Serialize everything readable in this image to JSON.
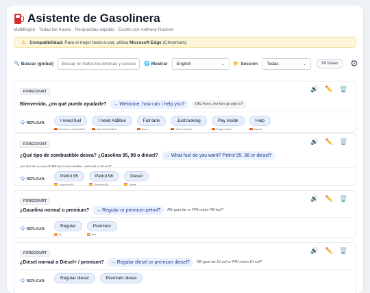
{
  "header": {
    "title": "Asistente de Gasolinera",
    "subtitle": "Multilingüe · Todas las frases · Respuestas rápidas · Escrito por Anthony Rostron"
  },
  "banner": {
    "prefix": "Compatibilidad:",
    "text": " Para el mejor texto-a-voz, utiliza ",
    "highlight": "Microsoft Edge",
    "suffix": " (Chromium)."
  },
  "toolbar": {
    "search_label": "Buscar (global)",
    "search_placeholder": "Buscar en todos los idiomas y secciones",
    "show_label": "Mostrar",
    "language_value": "English",
    "section_label": "Sección",
    "section_value": "Todas",
    "count_label": "90 frases"
  },
  "reply_label": "REPLICAR:",
  "cards": [
    {
      "tag": "FORECOURT",
      "question": "Bienvenido, ¿en qué puedo ayudarle?",
      "translation": "→ Welcome, how can I help you?",
      "phonetic": "UEL-kom, jou kan ay jelp iu?",
      "replies": [
        {
          "label": "I need fuel",
          "sub": "Necesito combustible"
        },
        {
          "label": "I need AdBlue",
          "sub": "Necesito AdBlue"
        },
        {
          "label": "Full tank",
          "sub": "Lleno"
        },
        {
          "label": "Just looking",
          "sub": "Solo mirando"
        },
        {
          "label": "Pay inside",
          "sub": "Pagar dentro"
        },
        {
          "label": "Help",
          "sub": "Ayuda"
        }
      ]
    },
    {
      "tag": "FORECOURT",
      "question": "¿Qué tipo de combustible desea? ¿Gasolina 95, 98 o diésel?",
      "translation": "→ What fuel do you want? Petrol 95, 98 or diesel?",
      "phonetic": "uot fiul du iu uont? PE-trol naín-ti-fáiv, naín-titi o di-sol?",
      "replies": [
        {
          "label": "Petrol 95",
          "sub": "Gasolina 95"
        },
        {
          "label": "Petrol 98",
          "sub": "Gasolina 98"
        },
        {
          "label": "Diesel",
          "sub": "Diesel"
        }
      ]
    },
    {
      "tag": "FORECOURT",
      "question": "¿Gasolina normal o premium?",
      "translation": "→ Regular or premium petrol?",
      "phonetic": "RE-guiu-lar or PRÍ-mium PE-trol?",
      "replies": [
        {
          "label": "Regular",
          "sub": "N"
        },
        {
          "label": "Premium",
          "sub": "Pre"
        }
      ]
    },
    {
      "tag": "FORECOURT",
      "question": "¿Diésel normal o Diésel+ / premium?",
      "translation": "→ Regular diesel or premium diesel?",
      "phonetic": "RE-guiu-lar DÍ-sol or PRÍ-mium DÍ-sol?",
      "replies": [
        {
          "label": "Regular diesel",
          "sub": ""
        },
        {
          "label": "Premium diesel",
          "sub": ""
        }
      ]
    }
  ]
}
